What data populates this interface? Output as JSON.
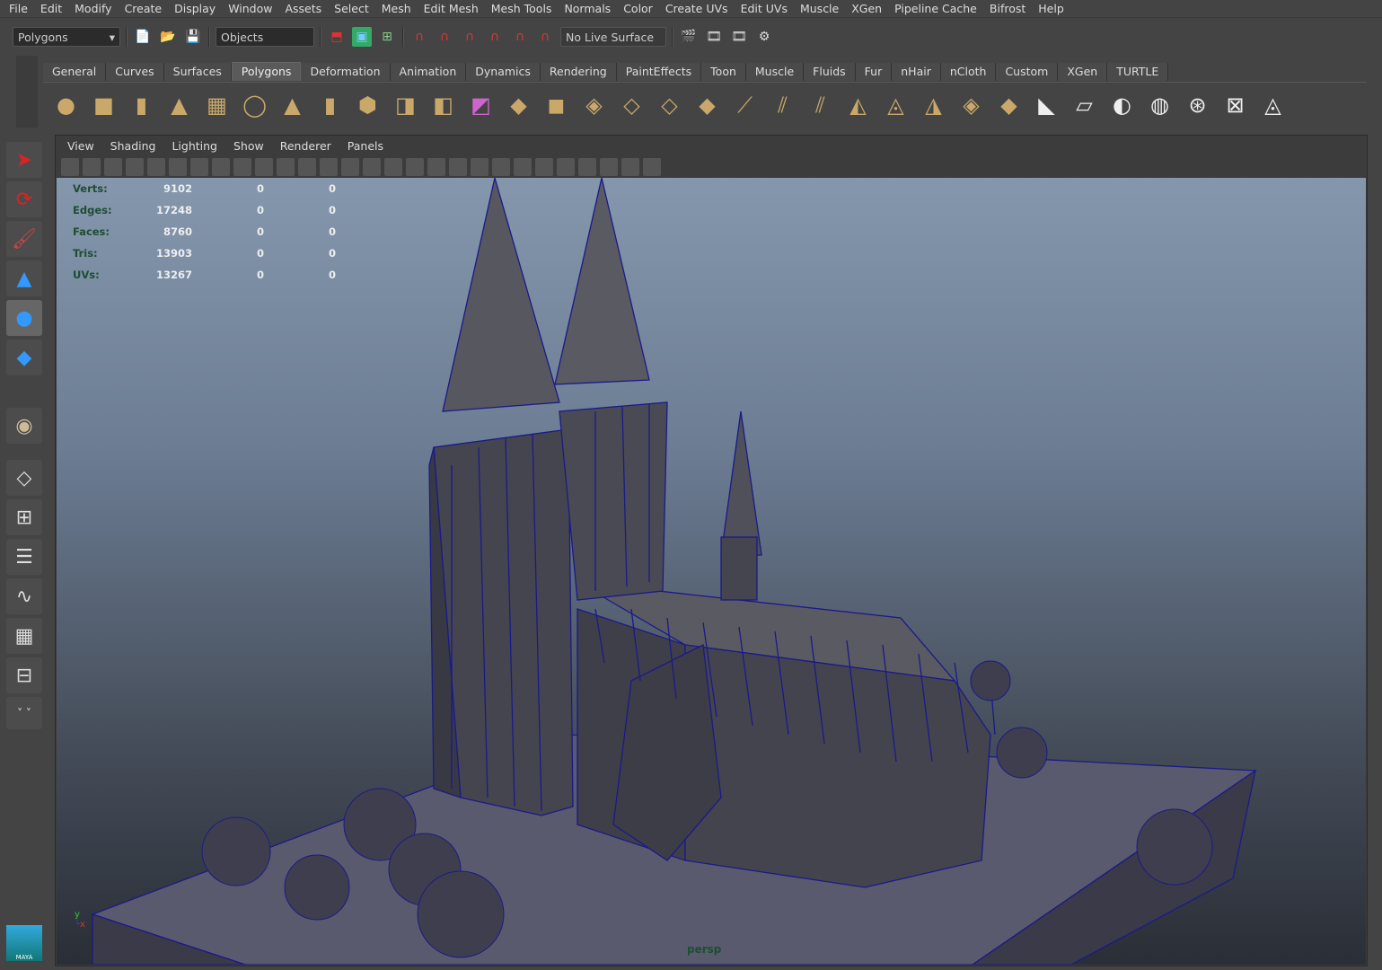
{
  "menubar": {
    "items": [
      "File",
      "Edit",
      "Modify",
      "Create",
      "Display",
      "Window",
      "Assets",
      "Select",
      "Mesh",
      "Edit Mesh",
      "Mesh Tools",
      "Normals",
      "Color",
      "Create UVs",
      "Edit UVs",
      "Muscle",
      "XGen",
      "Pipeline Cache",
      "Bifrost",
      "Help"
    ]
  },
  "toolbar": {
    "mode_select": "Polygons",
    "selection_mask": "Objects",
    "live_surface": "No Live Surface"
  },
  "shelf": {
    "tabs": [
      "General",
      "Curves",
      "Surfaces",
      "Polygons",
      "Deformation",
      "Animation",
      "Dynamics",
      "Rendering",
      "PaintEffects",
      "Toon",
      "Muscle",
      "Fluids",
      "Fur",
      "nHair",
      "nCloth",
      "Custom",
      "XGen",
      "TURTLE"
    ],
    "active_tab": "Polygons"
  },
  "panel": {
    "menu": [
      "View",
      "Shading",
      "Lighting",
      "Show",
      "Renderer",
      "Panels"
    ],
    "camera": "persp"
  },
  "hud": {
    "rows": [
      {
        "label": "Verts:",
        "total": "9102",
        "sel": "0",
        "comp": "0"
      },
      {
        "label": "Edges:",
        "total": "17248",
        "sel": "0",
        "comp": "0"
      },
      {
        "label": "Faces:",
        "total": "8760",
        "sel": "0",
        "comp": "0"
      },
      {
        "label": "Tris:",
        "total": "13903",
        "sel": "0",
        "comp": "0"
      },
      {
        "label": "UVs:",
        "total": "13267",
        "sel": "0",
        "comp": "0"
      }
    ]
  },
  "axis": {
    "y": "y",
    "x": "x"
  },
  "logo": "MAYA",
  "colors": {
    "wire": "#1a1a8a",
    "mesh": "#4a4a55",
    "ui_bg": "#444444"
  }
}
